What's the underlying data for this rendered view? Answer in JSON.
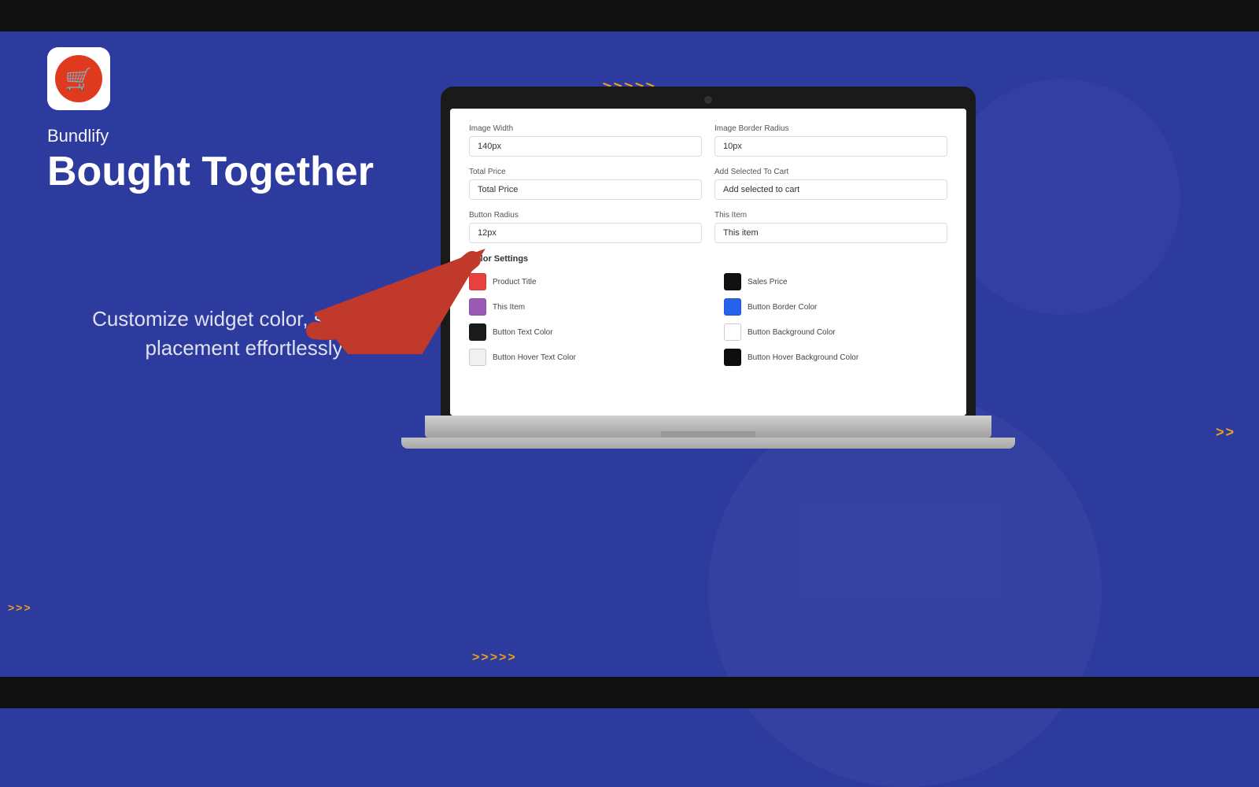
{
  "topBar": {
    "label": "top-bar"
  },
  "bottomBar": {
    "label": "bottom-bar"
  },
  "arrows": {
    "topCenter": ">>>>>",
    "bottomCenter": ">>>>>",
    "bottomRight": ">>",
    "bottomLeft": ">>>"
  },
  "brand": {
    "name": "Bundlify",
    "title": "Bought Together",
    "subtitle": "Customize widget color, size, and placement effortlessly"
  },
  "screen": {
    "fields": [
      {
        "label": "Image Width",
        "value": "140px"
      },
      {
        "label": "Image Border Radius",
        "value": "10px"
      },
      {
        "label": "Total Price",
        "value": "Total Price"
      },
      {
        "label": "Add Selected To Cart",
        "value": "Add selected to cart"
      },
      {
        "label": "Button Radius",
        "value": "12px"
      },
      {
        "label": "This Item",
        "value": "This item"
      }
    ],
    "colorSettings": {
      "title": "Color Settings",
      "colors": [
        {
          "id": "product-title",
          "label": "Product Title",
          "swatch": "swatch-red"
        },
        {
          "id": "sales-price",
          "label": "Sales Price",
          "swatch": "swatch-dark"
        },
        {
          "id": "this-item",
          "label": "This Item",
          "swatch": "swatch-purple"
        },
        {
          "id": "button-border",
          "label": "Button Border Color",
          "swatch": "swatch-blue"
        },
        {
          "id": "button-text",
          "label": "Button Text Color",
          "swatch": "swatch-black"
        },
        {
          "id": "button-bg",
          "label": "Button Background Color",
          "swatch": "swatch-white"
        },
        {
          "id": "button-hover-text",
          "label": "Button Hover Text Color",
          "swatch": "swatch-white-btn"
        },
        {
          "id": "button-hover-bg",
          "label": "Button Hover Background Color",
          "swatch": "swatch-dark2"
        }
      ]
    }
  }
}
